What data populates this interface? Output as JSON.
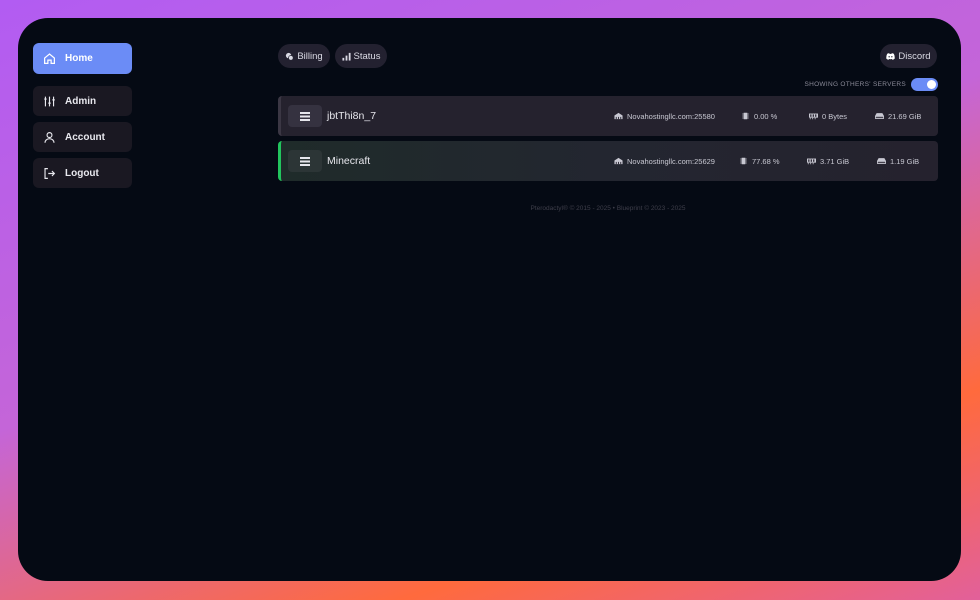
{
  "sidebar": {
    "items": [
      {
        "label": "Home",
        "icon": "home-icon",
        "active": true
      },
      {
        "label": "Admin",
        "icon": "sliders-icon"
      },
      {
        "label": "Account",
        "icon": "user-icon"
      },
      {
        "label": "Logout",
        "icon": "logout-icon"
      }
    ]
  },
  "topbar": {
    "billing_label": "Billing",
    "status_label": "Status",
    "discord_label": "Discord",
    "toggle_label": "SHOWING OTHERS' SERVERS",
    "toggle_on": true
  },
  "servers": [
    {
      "name": "jbtThi8n_7",
      "address": "Novahostingllc.com:25580",
      "cpu": "0.00 %",
      "memory": "0 Bytes",
      "disk": "21.69 GiB",
      "status_color": "#3b3744"
    },
    {
      "name": "Minecraft",
      "address": "Novahostingllc.com:25629",
      "cpu": "77.68 %",
      "memory": "3.71 GiB",
      "disk": "1.19 GiB",
      "status_color": "#22c55e"
    }
  ],
  "footer": "Pterodactyl® © 2015 - 2025  •  Blueprint © 2023 - 2025",
  "colors": {
    "accent": "#6b8cf6",
    "background": "#050a14",
    "online": "#22c55e"
  }
}
